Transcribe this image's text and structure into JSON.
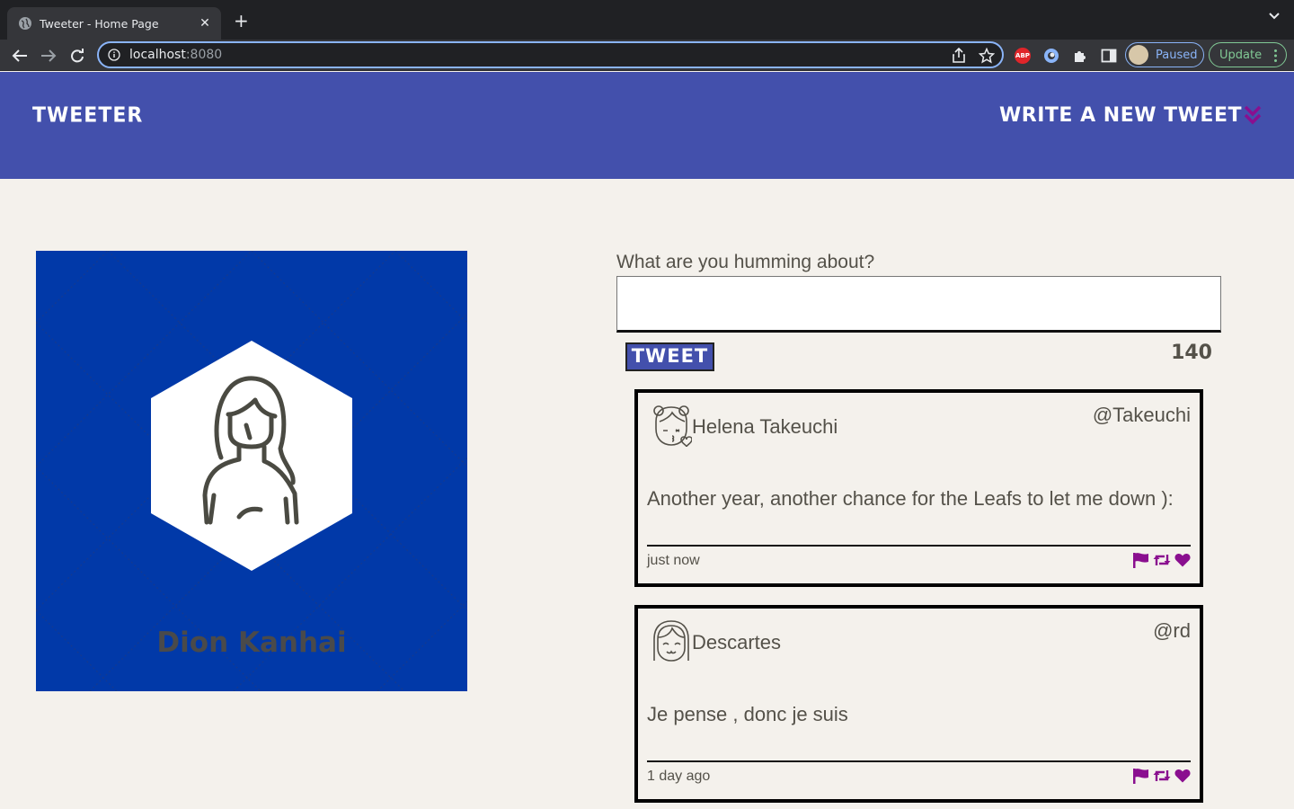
{
  "browser": {
    "tab_title": "Tweeter - Home Page",
    "url_host": "localhost",
    "url_port": ":8080",
    "profile_label": "Paused",
    "update_label": "Update",
    "abp_label": "ABP"
  },
  "header": {
    "brand": "Tweeter",
    "write_new": "Write a new tweet"
  },
  "profile": {
    "name": "Dion Kanhai"
  },
  "compose": {
    "label": "What are you humming about?",
    "value": "",
    "button": "Tweet",
    "counter": "140"
  },
  "tweets": [
    {
      "name": "Helena Takeuchi",
      "handle": "@Takeuchi",
      "content": "Another year, another chance for the Leafs to let me down ):",
      "time": "just now"
    },
    {
      "name": "Descartes",
      "handle": "@rd",
      "content": "Je pense , donc je suis",
      "time": "1 day ago"
    }
  ],
  "colors": {
    "header_bg": "#4350ac",
    "profile_bg": "#0139a8",
    "page_bg": "#f4f1ec",
    "accent": "#8a0f8f",
    "text": "#545149"
  }
}
